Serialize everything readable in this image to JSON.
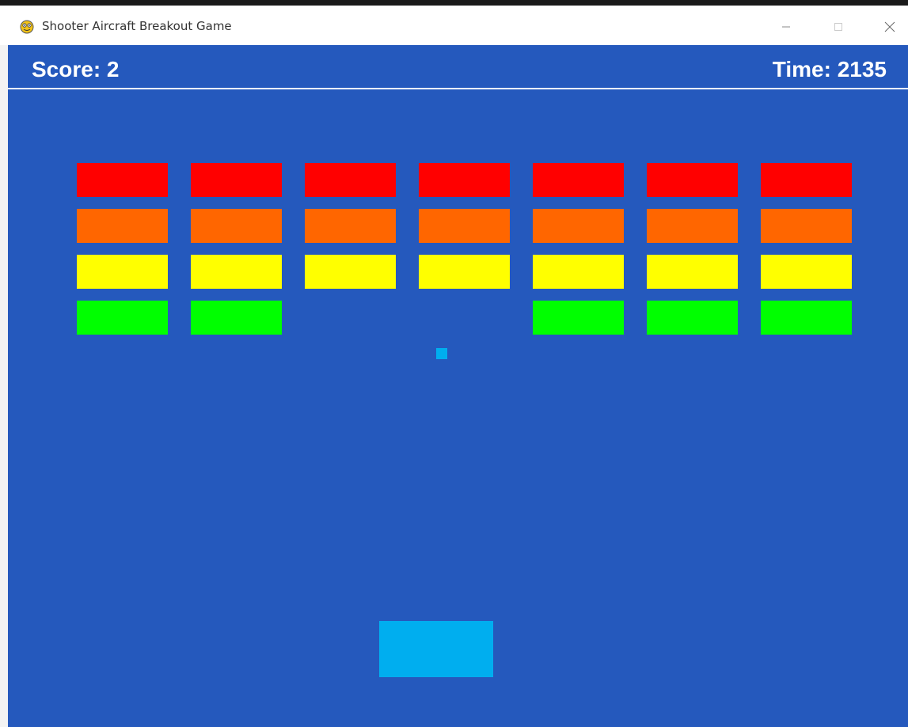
{
  "window": {
    "title": "Shooter Aircraft Breakout Game",
    "icon": "pygame-snake-icon",
    "controls": [
      "minimize-icon",
      "maximize-icon",
      "close-icon"
    ]
  },
  "hud": {
    "score_label": "Score: 2",
    "time_label": "Time: 2135"
  },
  "colors": {
    "background": "#2559BD",
    "hud_text": "#FFFFFF",
    "ball": "#00AEEF",
    "paddle": "#00AEEF",
    "row_colors": [
      "#FF0000",
      "#FF6600",
      "#FFFF00",
      "#00FF00"
    ]
  },
  "bricks": {
    "rows": [
      {
        "color_name": "red",
        "present": [
          true,
          true,
          true,
          true,
          true,
          true,
          true
        ]
      },
      {
        "color_name": "orange",
        "present": [
          true,
          true,
          true,
          true,
          true,
          true,
          true
        ]
      },
      {
        "color_name": "yellow",
        "present": [
          true,
          true,
          true,
          true,
          true,
          true,
          true
        ]
      },
      {
        "color_name": "green",
        "present": [
          true,
          true,
          false,
          false,
          true,
          true,
          true
        ]
      }
    ]
  }
}
